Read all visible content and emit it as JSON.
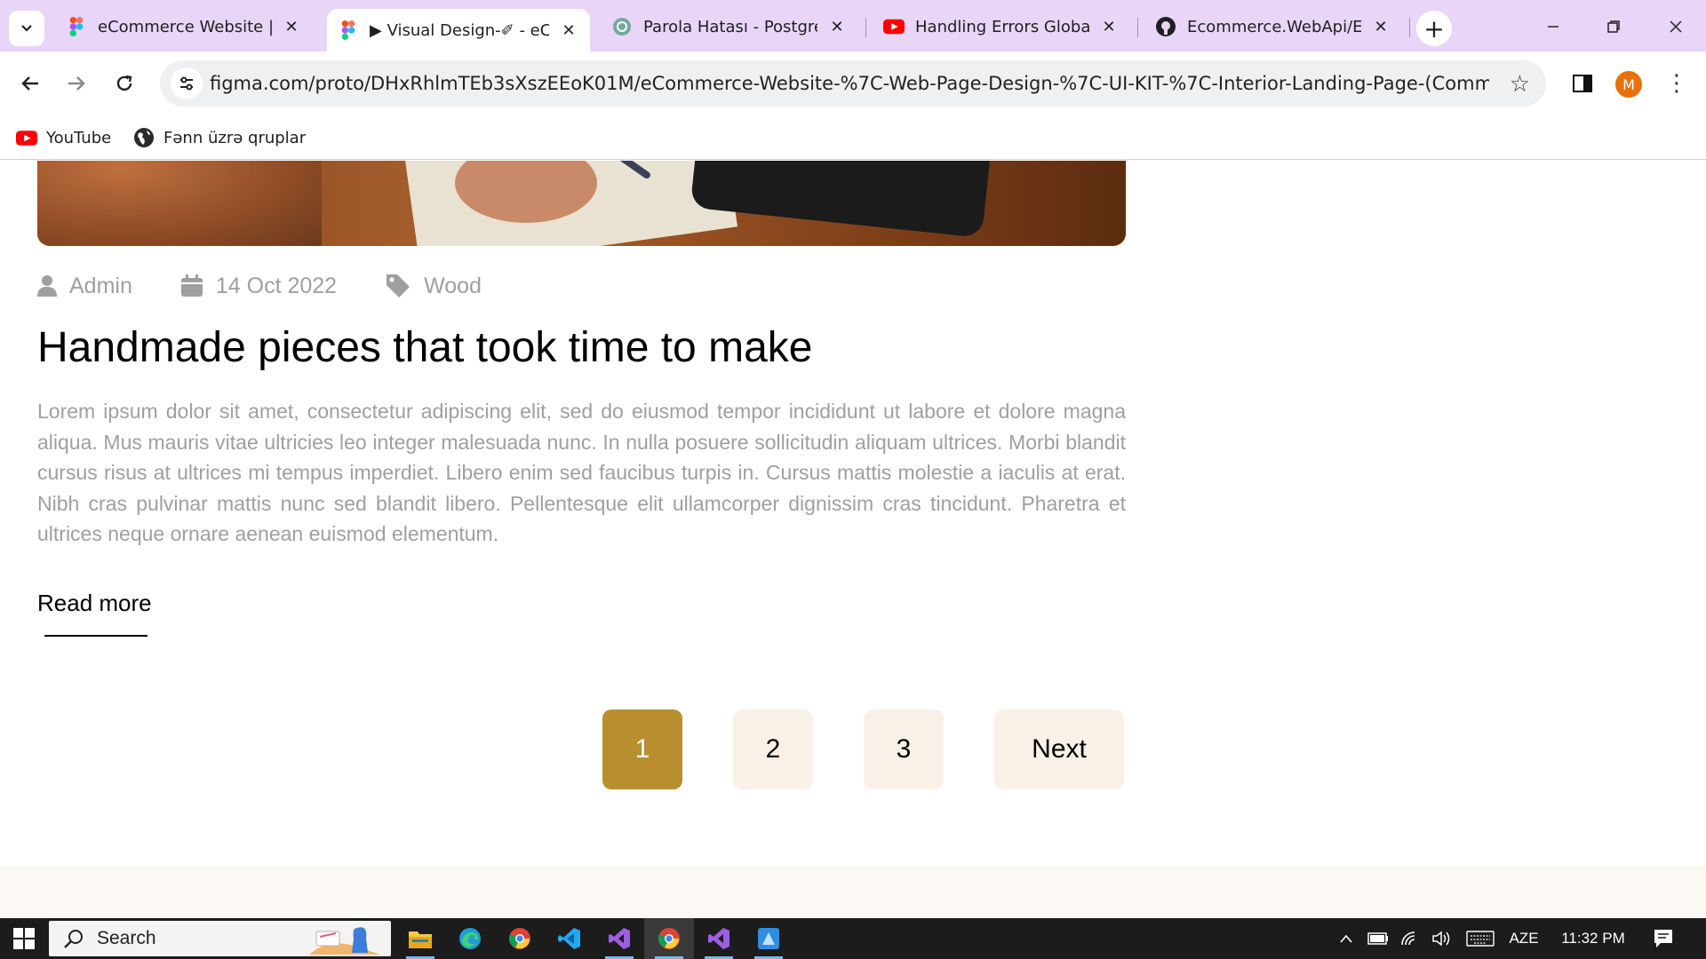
{
  "browser": {
    "tabs": [
      {
        "title": "eCommerce Website | We",
        "icon": "figma-icon",
        "active": false
      },
      {
        "title": "▶ Visual Design-✐ - eCon",
        "icon": "figma-icon",
        "active": true
      },
      {
        "title": "Parola Hatası - PostgreSC",
        "icon": "chatgpt-icon",
        "active": false
      },
      {
        "title": "Handling Errors Globally",
        "icon": "youtube-icon",
        "active": false
      },
      {
        "title": "Ecommerce.WebApi/Ecor",
        "icon": "github-icon",
        "active": false
      }
    ],
    "url": "figma.com/proto/DHxRhlmTEb3sXszEEoK01M/eCommerce-Website-%7C-Web-Page-Design-%7C-UI-KIT-%7C-Interior-Landing-Page-(Community)?type=...",
    "profile_initial": "M",
    "bookmarks": [
      {
        "label": "YouTube",
        "icon": "youtube-icon"
      },
      {
        "label": "Fənn üzrə qruplar",
        "icon": "globe-icon"
      }
    ]
  },
  "post": {
    "author": "Admin",
    "date": "14 Oct 2022",
    "category": "Wood",
    "title": "Handmade pieces that took time to make",
    "body": "Lorem ipsum dolor sit amet, consectetur adipiscing elit, sed do eiusmod tempor incididunt ut labore et dolore magna aliqua. Mus mauris vitae ultricies leo integer malesuada nunc. In nulla posuere sollicitudin aliquam ultrices. Morbi blandit cursus risus at ultrices mi tempus imperdiet. Libero enim sed faucibus turpis in. Cursus mattis molestie a iaculis at erat. Nibh cras pulvinar mattis nunc sed blandit libero. Pellentesque elit ullamcorper dignissim cras tincidunt. Pharetra et ultrices neque ornare aenean euismod elementum.",
    "read_more": "Read more"
  },
  "pagination": {
    "pages": [
      "1",
      "2",
      "3"
    ],
    "active_page": "1",
    "next_label": "Next"
  },
  "colors": {
    "accent": "#B88E2F",
    "page_button_bg": "#F9F1E7",
    "muted_text": "#9F9F9F",
    "tab_strip": "#E9D5F7"
  },
  "taskbar": {
    "search_placeholder": "Search",
    "language": "AZE",
    "time": "11:32 PM",
    "pinned_apps": [
      "file-explorer-icon",
      "edge-icon",
      "chrome-icon",
      "vscode-icon",
      "visual-studio-icon",
      "chrome-icon",
      "visual-studio-icon",
      "azure-data-studio-icon"
    ]
  }
}
